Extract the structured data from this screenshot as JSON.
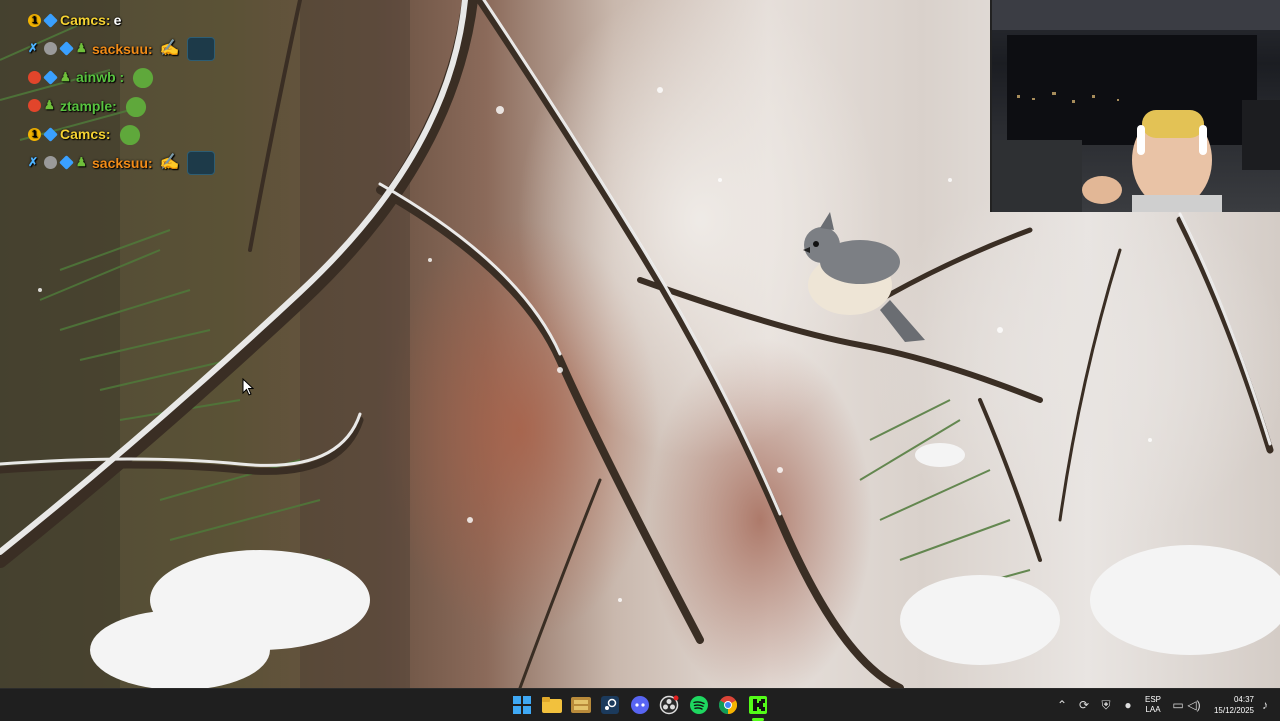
{
  "chat": {
    "messages": [
      {
        "user": "Camcs:",
        "text": "e",
        "badges": [
          "gold",
          "blue"
        ],
        "emotes": []
      },
      {
        "user": "sacksuu:",
        "text": "",
        "badges": [
          "sword",
          "gray",
          "blue",
          "green"
        ],
        "emotes": [
          "sketch",
          "box"
        ]
      },
      {
        "user": "ainwb :",
        "text": "",
        "badges": [
          "red",
          "blue",
          "green"
        ],
        "emotes": [
          "frog"
        ]
      },
      {
        "user": "ztample:",
        "text": "",
        "badges": [
          "red",
          "green"
        ],
        "emotes": [
          "frog"
        ]
      },
      {
        "user": "Camcs:",
        "text": "",
        "badges": [
          "gold",
          "blue"
        ],
        "emotes": [
          "frog"
        ]
      },
      {
        "user": "sacksuu:",
        "text": "",
        "badges": [
          "sword",
          "gray",
          "blue",
          "green"
        ],
        "emotes": [
          "sketch",
          "box"
        ]
      }
    ]
  },
  "taskbar": {
    "apps": [
      "windows-start-icon",
      "file-explorer-icon",
      "gallery-icon",
      "steam-icon",
      "discord-icon",
      "obs-icon",
      "spotify-icon",
      "chrome-icon",
      "kick-icon"
    ],
    "tray": {
      "language_line1": "ESP",
      "language_line2": "LAA",
      "time": "04:37",
      "date": "15/12/2025"
    }
  },
  "colors": {
    "taskbar_bg": "#1f1f1f",
    "username_gold": "#f5d232",
    "username_orange": "#f28c18",
    "username_green": "#58c23f"
  }
}
